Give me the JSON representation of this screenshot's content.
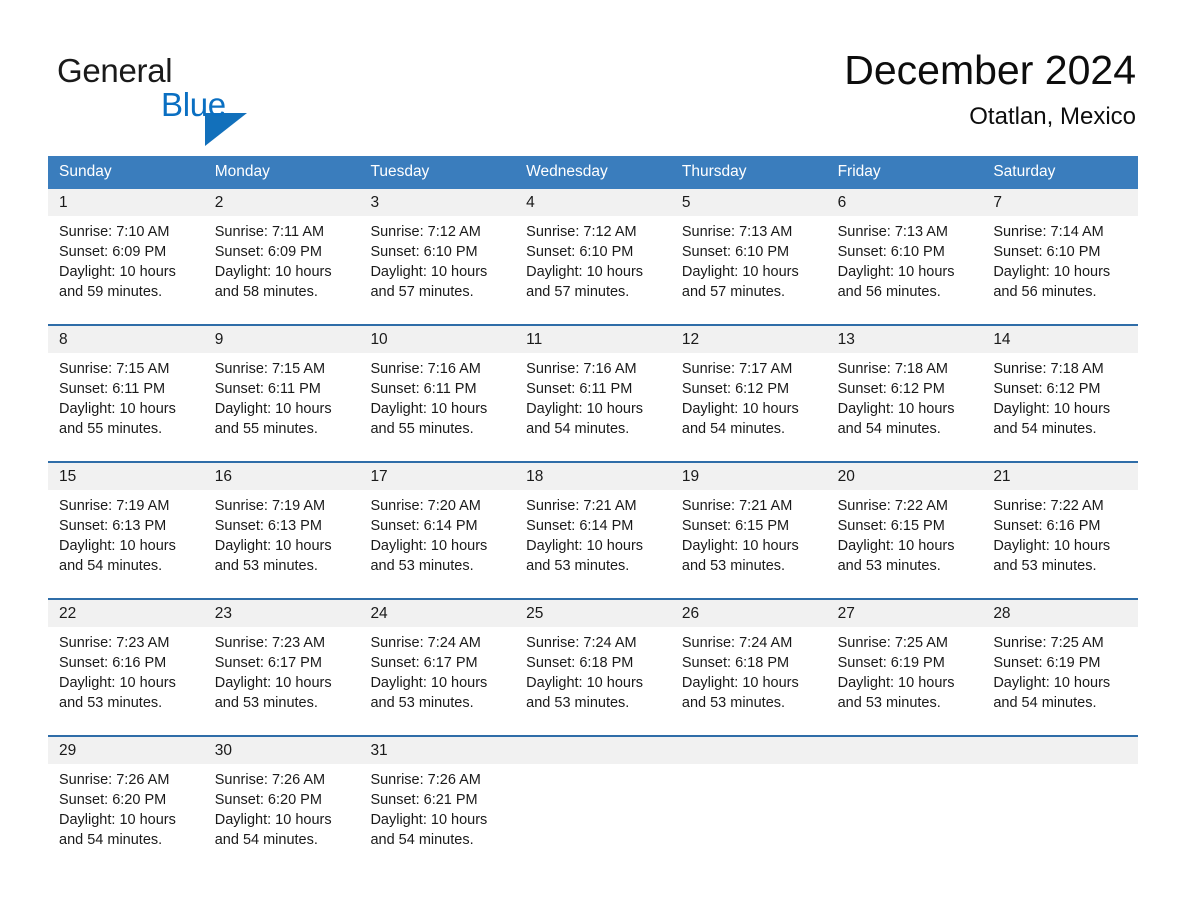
{
  "brand": {
    "name_part1": "General",
    "name_part2": "Blue",
    "accent_color": "#1270bb",
    "blue_text_color": "#0a6fc2"
  },
  "header": {
    "title": "December 2024",
    "subtitle": "Otatlan, Mexico"
  },
  "calendar": {
    "header_bg": "#3a7dbd",
    "daynum_bg": "#f1f1f1",
    "rule_color": "#2f6da8",
    "weekdays": [
      "Sunday",
      "Monday",
      "Tuesday",
      "Wednesday",
      "Thursday",
      "Friday",
      "Saturday"
    ],
    "weeks": [
      {
        "daynums": [
          "1",
          "2",
          "3",
          "4",
          "5",
          "6",
          "7"
        ],
        "cells": [
          {
            "sunrise": "Sunrise: 7:10 AM",
            "sunset": "Sunset: 6:09 PM",
            "daylight": "Daylight: 10 hours and 59 minutes."
          },
          {
            "sunrise": "Sunrise: 7:11 AM",
            "sunset": "Sunset: 6:09 PM",
            "daylight": "Daylight: 10 hours and 58 minutes."
          },
          {
            "sunrise": "Sunrise: 7:12 AM",
            "sunset": "Sunset: 6:10 PM",
            "daylight": "Daylight: 10 hours and 57 minutes."
          },
          {
            "sunrise": "Sunrise: 7:12 AM",
            "sunset": "Sunset: 6:10 PM",
            "daylight": "Daylight: 10 hours and 57 minutes."
          },
          {
            "sunrise": "Sunrise: 7:13 AM",
            "sunset": "Sunset: 6:10 PM",
            "daylight": "Daylight: 10 hours and 57 minutes."
          },
          {
            "sunrise": "Sunrise: 7:13 AM",
            "sunset": "Sunset: 6:10 PM",
            "daylight": "Daylight: 10 hours and 56 minutes."
          },
          {
            "sunrise": "Sunrise: 7:14 AM",
            "sunset": "Sunset: 6:10 PM",
            "daylight": "Daylight: 10 hours and 56 minutes."
          }
        ]
      },
      {
        "daynums": [
          "8",
          "9",
          "10",
          "11",
          "12",
          "13",
          "14"
        ],
        "cells": [
          {
            "sunrise": "Sunrise: 7:15 AM",
            "sunset": "Sunset: 6:11 PM",
            "daylight": "Daylight: 10 hours and 55 minutes."
          },
          {
            "sunrise": "Sunrise: 7:15 AM",
            "sunset": "Sunset: 6:11 PM",
            "daylight": "Daylight: 10 hours and 55 minutes."
          },
          {
            "sunrise": "Sunrise: 7:16 AM",
            "sunset": "Sunset: 6:11 PM",
            "daylight": "Daylight: 10 hours and 55 minutes."
          },
          {
            "sunrise": "Sunrise: 7:16 AM",
            "sunset": "Sunset: 6:11 PM",
            "daylight": "Daylight: 10 hours and 54 minutes."
          },
          {
            "sunrise": "Sunrise: 7:17 AM",
            "sunset": "Sunset: 6:12 PM",
            "daylight": "Daylight: 10 hours and 54 minutes."
          },
          {
            "sunrise": "Sunrise: 7:18 AM",
            "sunset": "Sunset: 6:12 PM",
            "daylight": "Daylight: 10 hours and 54 minutes."
          },
          {
            "sunrise": "Sunrise: 7:18 AM",
            "sunset": "Sunset: 6:12 PM",
            "daylight": "Daylight: 10 hours and 54 minutes."
          }
        ]
      },
      {
        "daynums": [
          "15",
          "16",
          "17",
          "18",
          "19",
          "20",
          "21"
        ],
        "cells": [
          {
            "sunrise": "Sunrise: 7:19 AM",
            "sunset": "Sunset: 6:13 PM",
            "daylight": "Daylight: 10 hours and 54 minutes."
          },
          {
            "sunrise": "Sunrise: 7:19 AM",
            "sunset": "Sunset: 6:13 PM",
            "daylight": "Daylight: 10 hours and 53 minutes."
          },
          {
            "sunrise": "Sunrise: 7:20 AM",
            "sunset": "Sunset: 6:14 PM",
            "daylight": "Daylight: 10 hours and 53 minutes."
          },
          {
            "sunrise": "Sunrise: 7:21 AM",
            "sunset": "Sunset: 6:14 PM",
            "daylight": "Daylight: 10 hours and 53 minutes."
          },
          {
            "sunrise": "Sunrise: 7:21 AM",
            "sunset": "Sunset: 6:15 PM",
            "daylight": "Daylight: 10 hours and 53 minutes."
          },
          {
            "sunrise": "Sunrise: 7:22 AM",
            "sunset": "Sunset: 6:15 PM",
            "daylight": "Daylight: 10 hours and 53 minutes."
          },
          {
            "sunrise": "Sunrise: 7:22 AM",
            "sunset": "Sunset: 6:16 PM",
            "daylight": "Daylight: 10 hours and 53 minutes."
          }
        ]
      },
      {
        "daynums": [
          "22",
          "23",
          "24",
          "25",
          "26",
          "27",
          "28"
        ],
        "cells": [
          {
            "sunrise": "Sunrise: 7:23 AM",
            "sunset": "Sunset: 6:16 PM",
            "daylight": "Daylight: 10 hours and 53 minutes."
          },
          {
            "sunrise": "Sunrise: 7:23 AM",
            "sunset": "Sunset: 6:17 PM",
            "daylight": "Daylight: 10 hours and 53 minutes."
          },
          {
            "sunrise": "Sunrise: 7:24 AM",
            "sunset": "Sunset: 6:17 PM",
            "daylight": "Daylight: 10 hours and 53 minutes."
          },
          {
            "sunrise": "Sunrise: 7:24 AM",
            "sunset": "Sunset: 6:18 PM",
            "daylight": "Daylight: 10 hours and 53 minutes."
          },
          {
            "sunrise": "Sunrise: 7:24 AM",
            "sunset": "Sunset: 6:18 PM",
            "daylight": "Daylight: 10 hours and 53 minutes."
          },
          {
            "sunrise": "Sunrise: 7:25 AM",
            "sunset": "Sunset: 6:19 PM",
            "daylight": "Daylight: 10 hours and 53 minutes."
          },
          {
            "sunrise": "Sunrise: 7:25 AM",
            "sunset": "Sunset: 6:19 PM",
            "daylight": "Daylight: 10 hours and 54 minutes."
          }
        ]
      },
      {
        "daynums": [
          "29",
          "30",
          "31",
          "",
          "",
          "",
          ""
        ],
        "cells": [
          {
            "sunrise": "Sunrise: 7:26 AM",
            "sunset": "Sunset: 6:20 PM",
            "daylight": "Daylight: 10 hours and 54 minutes."
          },
          {
            "sunrise": "Sunrise: 7:26 AM",
            "sunset": "Sunset: 6:20 PM",
            "daylight": "Daylight: 10 hours and 54 minutes."
          },
          {
            "sunrise": "Sunrise: 7:26 AM",
            "sunset": "Sunset: 6:21 PM",
            "daylight": "Daylight: 10 hours and 54 minutes."
          },
          {
            "sunrise": "",
            "sunset": "",
            "daylight": ""
          },
          {
            "sunrise": "",
            "sunset": "",
            "daylight": ""
          },
          {
            "sunrise": "",
            "sunset": "",
            "daylight": ""
          },
          {
            "sunrise": "",
            "sunset": "",
            "daylight": ""
          }
        ]
      }
    ]
  }
}
